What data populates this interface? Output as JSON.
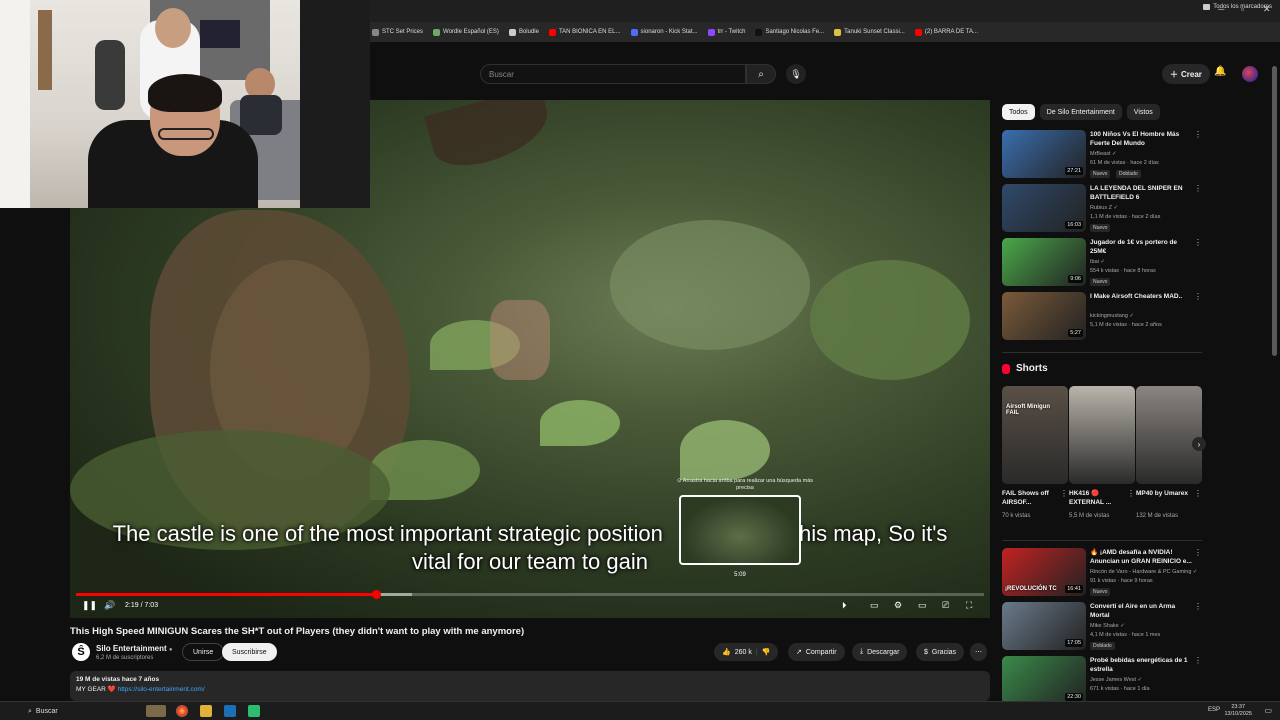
{
  "browser": {
    "bookmarks": [
      {
        "label": "STC Set Prices",
        "color": "#888888"
      },
      {
        "label": "Wordle Español (ES)",
        "color": "#6aaa64"
      },
      {
        "label": "Boludle",
        "color": "#cccccc"
      },
      {
        "label": "TAN BIONICA EN EL...",
        "color": "#ff0000"
      },
      {
        "label": "sionaron - Kick Stat...",
        "color": "#4f6ef7"
      },
      {
        "label": "trr - Twitch",
        "color": "#9146ff"
      },
      {
        "label": "Santiago Nicolas Fe...",
        "color": "#111111"
      },
      {
        "label": "Tanuki Sunset Classi...",
        "color": "#e0c040"
      },
      {
        "label": "(2) BARRA DE TA...",
        "color": "#ff0000"
      }
    ],
    "all_bookmarks": "Todos los marcadores"
  },
  "header": {
    "search_placeholder": "Buscar",
    "create_label": "Crear"
  },
  "player": {
    "subtitle_line1": "The castle is one of the most important strategic position",
    "subtitle_line1_end": "this map, So it's",
    "subtitle_line2": "vital for our team to gain",
    "preview_hint": "⊙ Arrastra hacia arriba para realizar una búsqueda más precisa",
    "preview_time": "5:09",
    "time_display": "2:19 / 7:03",
    "played_fraction": 0.33,
    "buffered_fraction": 0.37
  },
  "video": {
    "title": "This High Speed MINIGUN Scares the SH*T out of Players (they didn't want to play with me anymore)",
    "channel_name": "Silo Entertainment",
    "channel_subs": "6,2 M de suscriptores",
    "join_label": "Unirse",
    "subscribe_label": "Suscribirse",
    "likes": "260 k",
    "share_label": "Compartir",
    "download_label": "Descargar",
    "thanks_label": "Gracias",
    "desc_meta": "19 M de vistas  hace 7 años",
    "desc_gear": "MY GEAR ❤️",
    "desc_link": "https://silo-entertainment.com/"
  },
  "chips": [
    "Todos",
    "De Silo Entertainment",
    "Vistos"
  ],
  "recommendations": [
    {
      "title": "100 Niños Vs El Hombre Más Fuerte Del Mundo",
      "channel": "MrBeast ✓",
      "meta": "61 M de vistas · hace 2 días",
      "badges": [
        "Nuevo",
        "Doblado"
      ],
      "duration": "27:21",
      "thumb": "#3a6fb0"
    },
    {
      "title": "LA LEYENDA DEL SNIPER EN BATTLEFIELD 6",
      "channel": "Rubius Z ✓",
      "meta": "1,1 M de vistas · hace 2 días",
      "badges": [
        "Nuevo"
      ],
      "duration": "16:03",
      "thumb": "#2f4a6a"
    },
    {
      "title": "Jugador de 1€ vs portero de 25M€",
      "channel": "Ibai ✓",
      "meta": "554 k vistas · hace 8 horas",
      "badges": [
        "Nuevo"
      ],
      "duration": "9:06",
      "thumb": "#4aa84a"
    },
    {
      "title": "I Make Airsoft Cheaters MAD..",
      "channel": "kickingmustang ✓",
      "meta": "5,1 M de vistas · hace 2 años",
      "badges": [],
      "duration": "5:27",
      "thumb": "#7a5a3a"
    }
  ],
  "shorts_title": "Shorts",
  "shorts": [
    {
      "title": "FAIL Shows off AIRSOF...",
      "views": "70 k vistas",
      "thumb": "#5a5046",
      "overlay": "Airsoft Minigun FAIL"
    },
    {
      "title": "HK416 🔴 EXTERNAL ...",
      "views": "5,5 M de vistas",
      "thumb": "#b9b4ab",
      "overlay": ""
    },
    {
      "title": "MP40 by Umarex",
      "views": "132 M de vistas",
      "thumb": "#8a8580",
      "overlay": ""
    }
  ],
  "recommendations2": [
    {
      "title": "🔥 ¡AMD desafía a NVIDIA! Anuncian un GRAN REINICIO e...",
      "channel": "Rincón de Varo - Hardware & PC Gaming ✓",
      "meta": "91 k vistas · hace 9 horas",
      "badges": [
        "Nuevo"
      ],
      "duration": "16:41",
      "thumb": "#c22222",
      "overlay": "¡REVOLUCIÓN TC"
    },
    {
      "title": "Convertí el Aire en un Arma Mortal",
      "channel": "Mike Shake ✓",
      "meta": "4,1 M de vistas · hace 1 mes",
      "badges": [
        "Doblado"
      ],
      "duration": "17:05",
      "thumb": "#6a7a8a",
      "overlay": ""
    },
    {
      "title": "Probé bebidas energéticas de 1 estrella",
      "channel": "Jesse James West ✓",
      "meta": "671 k vistas · hace 1 día",
      "badges": [],
      "duration": "22:30",
      "thumb": "#3a8a4a",
      "overlay": ""
    }
  ],
  "taskbar": {
    "search_label": "Buscar",
    "lang": "ESP",
    "time": "23:37",
    "date": "13/10/2025"
  }
}
